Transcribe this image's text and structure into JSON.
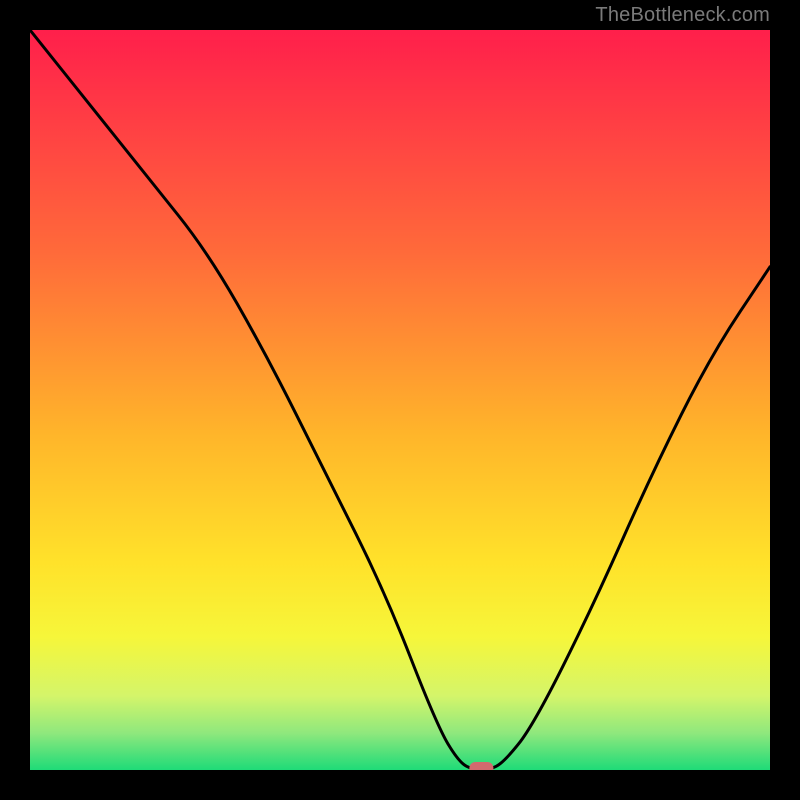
{
  "watermark": "TheBottleneck.com",
  "chart_data": {
    "type": "line",
    "title": "",
    "xlabel": "",
    "ylabel": "",
    "xlim": [
      0,
      100
    ],
    "ylim": [
      0,
      100
    ],
    "x": [
      0,
      8,
      16,
      24,
      32,
      40,
      48,
      55,
      58,
      60,
      62,
      64,
      68,
      76,
      84,
      92,
      100
    ],
    "values": [
      100,
      90,
      80,
      70,
      56,
      40,
      24,
      6,
      1,
      0,
      0,
      1,
      6,
      22,
      40,
      56,
      68
    ],
    "minimum_marker": {
      "x": 61,
      "y": 0,
      "color": "#d26a6e"
    },
    "gradient_stops": [
      {
        "offset": 0.0,
        "color": "#ff1f4b"
      },
      {
        "offset": 0.3,
        "color": "#ff6a3a"
      },
      {
        "offset": 0.55,
        "color": "#ffb62a"
      },
      {
        "offset": 0.72,
        "color": "#ffe22a"
      },
      {
        "offset": 0.82,
        "color": "#f6f63a"
      },
      {
        "offset": 0.9,
        "color": "#d4f56a"
      },
      {
        "offset": 0.95,
        "color": "#8fe87d"
      },
      {
        "offset": 1.0,
        "color": "#1edb78"
      }
    ]
  }
}
